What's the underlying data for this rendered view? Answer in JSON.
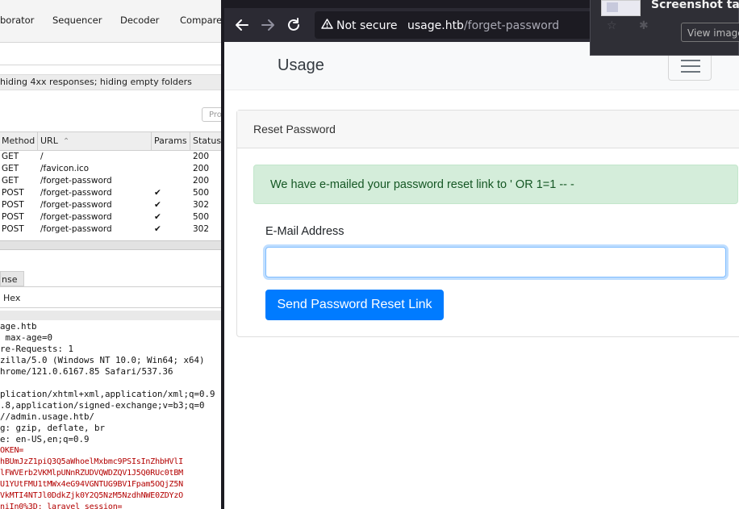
{
  "burp": {
    "tabs": [
      "borator",
      "Sequencer",
      "Decoder",
      "Comparer"
    ],
    "filter_text": "hiding 4xx responses;  hiding empty folders",
    "proxy_button": "Pro",
    "history": {
      "columns": [
        "Method",
        "URL",
        "Params",
        "Status"
      ],
      "sort_indicator": "^",
      "rows": [
        {
          "method": "GET",
          "url": "/",
          "params": "",
          "status": "200"
        },
        {
          "method": "GET",
          "url": "/favicon.ico",
          "params": "",
          "status": "200"
        },
        {
          "method": "GET",
          "url": "/forget-password",
          "params": "",
          "status": "200"
        },
        {
          "method": "POST",
          "url": "/forget-password",
          "params": "✔",
          "status": "500"
        },
        {
          "method": "POST",
          "url": "/forget-password",
          "params": "✔",
          "status": "302"
        },
        {
          "method": "POST",
          "url": "/forget-password",
          "params": "✔",
          "status": "500"
        },
        {
          "method": "POST",
          "url": "/forget-password",
          "params": "✔",
          "status": "302"
        }
      ]
    },
    "request_tab": "nse",
    "request_subtab": "Hex",
    "request_lines": [
      {
        "text": "age.htb",
        "style": "plain"
      },
      {
        "text": " max-age=0",
        "style": "plain"
      },
      {
        "text": "re-Requests: 1",
        "style": "plain"
      },
      {
        "text": "zilla/5.0 (Windows NT 10.0; Win64; x64)",
        "style": "plain"
      },
      {
        "text": "hrome/121.0.6167.85 Safari/537.36",
        "style": "plain"
      },
      {
        "text": "",
        "style": "plain"
      },
      {
        "text": "plication/xhtml+xml,application/xml;q=0.9",
        "style": "plain"
      },
      {
        "text": ".8,application/signed-exchange;v=b3;q=0",
        "style": "plain"
      },
      {
        "text": "//admin.usage.htb/",
        "style": "plain"
      },
      {
        "text": "g: gzip, deflate, br",
        "style": "plain"
      },
      {
        "text": "e: en-US,en;q=0.9",
        "style": "plain"
      },
      {
        "text": "OKEN=",
        "style": "red"
      },
      {
        "text": "hBUmJzZ1piQ3Q5aWhoelMxbmc9PSIsInZhbHVlI",
        "style": "red"
      },
      {
        "text": "lFWVErb2VKMlpUNnRZUDVQWDZQV1J5Q0RUc0tBM",
        "style": "red"
      },
      {
        "text": "U1YUtFMU1tMWx4eG94VGNTUG9BV1Fpam5OQjZ5N",
        "style": "red"
      },
      {
        "text": "VkMTI4NTJl0DdkZjk0Y2Q5NzM5NzdhNWE0ZDYzO",
        "style": "red"
      },
      {
        "text": "niIn0%3D; laravel_session=",
        "style": "red"
      }
    ]
  },
  "browser": {
    "url_security": "Not secure",
    "url_host": "usage.htb",
    "url_path": "/forget-password",
    "toast_title": "Screenshot take",
    "toast_button": "View image",
    "page": {
      "brand": "Usage",
      "card_title": "Reset Password",
      "alert": "We have e-mailed your password reset link to ' OR 1=1 -- -",
      "email_label": "E-Mail Address",
      "email_value": "",
      "submit_label": "Send Password Reset Link"
    }
  }
}
